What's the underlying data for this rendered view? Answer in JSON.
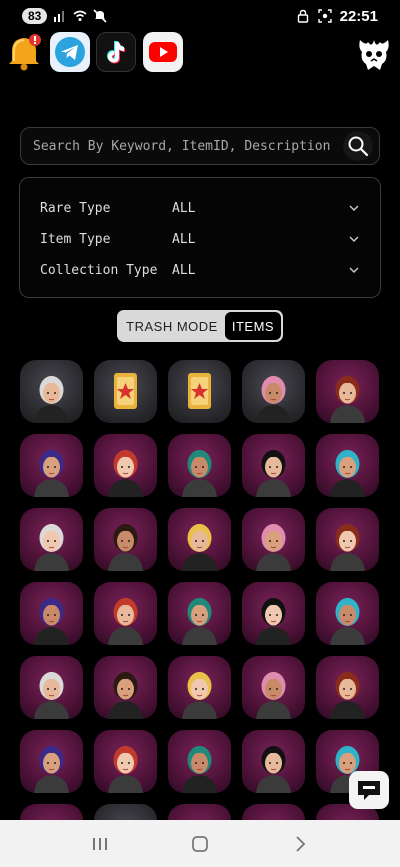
{
  "status_bar": {
    "battery": "83",
    "time": "22:51"
  },
  "apps": [
    {
      "name": "notification-bell"
    },
    {
      "name": "telegram"
    },
    {
      "name": "tiktok"
    },
    {
      "name": "youtube"
    }
  ],
  "search": {
    "placeholder": "Search By Keyword, ItemID, Description",
    "value": ""
  },
  "filters": [
    {
      "label": "Rare Type",
      "value": "ALL"
    },
    {
      "label": "Item Type",
      "value": "ALL"
    },
    {
      "label": "Collection Type",
      "value": "ALL"
    }
  ],
  "mode_toggle": {
    "trash_label": "TRASH MODE",
    "items_label": "ITEMS",
    "selected": "ITEMS"
  },
  "grid": {
    "rows": [
      [
        "grey-avatar",
        "voucher-card",
        "voucher-card",
        "grey-avatar",
        "pink-avatar"
      ],
      [
        "pink-avatar",
        "pink-avatar",
        "pink-avatar",
        "pink-avatar",
        "pink-avatar"
      ],
      [
        "pink-avatar",
        "pink-avatar",
        "pink-avatar",
        "pink-avatar",
        "pink-avatar"
      ],
      [
        "pink-avatar",
        "pink-avatar",
        "pink-avatar",
        "pink-avatar",
        "pink-avatar"
      ],
      [
        "pink-avatar",
        "pink-avatar",
        "pink-avatar",
        "pink-avatar",
        "pink-avatar"
      ],
      [
        "pink-avatar",
        "pink-avatar",
        "pink-avatar",
        "pink-avatar",
        "pink-avatar"
      ],
      [
        "pink-avatar",
        "grey-avatar",
        "pink-avatar",
        "pink-avatar",
        "pink-avatar"
      ]
    ]
  },
  "colors": {
    "tile_pink": "#4e1238",
    "tile_grey": "#2b2b30",
    "background": "#000000",
    "nav_bar": "#f2f2f2"
  }
}
